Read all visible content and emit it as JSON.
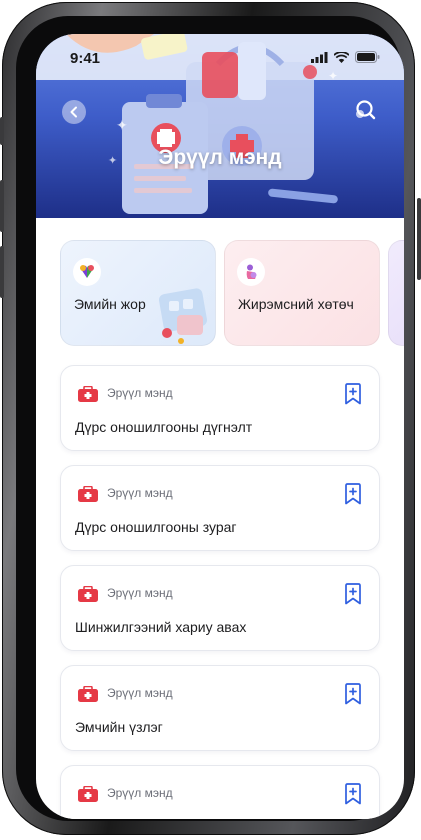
{
  "status_bar": {
    "time": "9:41"
  },
  "header": {
    "title": "Эрүүл мэнд"
  },
  "quick_cards": [
    {
      "label": "Эмийн жор",
      "bg": "#e6f0fc"
    },
    {
      "label": "Жирэмсний хөтөч",
      "bg": "#fde8ea"
    }
  ],
  "list": [
    {
      "category": "Эрүүл мэнд",
      "title": "Дүрс оношилгооны дүгнэлт"
    },
    {
      "category": "Эрүүл мэнд",
      "title": "Дүрс оношилгооны зураг"
    },
    {
      "category": "Эрүүл мэнд",
      "title": "Шинжилгээний хариу авах"
    },
    {
      "category": "Эрүүл мэнд",
      "title": "Эмчийн үзлэг"
    },
    {
      "category": "Эрүүл мэнд",
      "title": ""
    }
  ],
  "colors": {
    "accent": "#3e5dc9",
    "bookmark": "#2f5fe0",
    "category_icon": "#e53945"
  },
  "icons": {
    "back": "back-arrow-icon",
    "search": "search-icon",
    "bookmark": "bookmark-add-icon",
    "category": "medical-kit-icon"
  }
}
